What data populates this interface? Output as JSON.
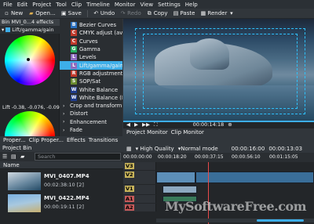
{
  "menu": [
    "File",
    "Edit",
    "Project",
    "Tool",
    "Clip",
    "Timeline",
    "Monitor",
    "View",
    "Settings",
    "Help"
  ],
  "toolbar": {
    "new": "New",
    "open": "Open...",
    "save": "Save",
    "undo": "Undo",
    "redo": "Redo",
    "copy": "Copy",
    "paste": "Paste",
    "render": "Render"
  },
  "effect_panel": {
    "bin_title": "Bin MVI_0...4 effects",
    "effect_name": "Lift/gamma/gain",
    "lift_value": "Lift -0.38, -0.076, -0.09:"
  },
  "effect_list": {
    "items": [
      {
        "badge": "B",
        "label": "Bezier Curves",
        "color": "#2a6fbf"
      },
      {
        "badge": "C",
        "label": "CMYK adjust (avfi",
        "color": "#c0392b"
      },
      {
        "badge": "C",
        "label": "Curves",
        "color": "#c0392b"
      },
      {
        "badge": "G",
        "label": "Gamma",
        "color": "#27ae60"
      },
      {
        "badge": "L",
        "label": "Levels",
        "color": "#8e6bbf"
      },
      {
        "badge": "L",
        "label": "Lift/gamma/gain",
        "color": "#8e6bbf",
        "selected": true
      },
      {
        "badge": "R",
        "label": "RGB adjustment",
        "color": "#c0392b"
      },
      {
        "badge": "S",
        "label": "SOP/Sat",
        "color": "#6a8a2f"
      },
      {
        "badge": "W",
        "label": "White Balance",
        "color": "#1e3a8a"
      },
      {
        "badge": "W",
        "label": "White Balance (LM",
        "color": "#1e3a8a"
      }
    ],
    "categories": [
      "Crop and transform",
      "Distort",
      "Enhancement",
      "Fade"
    ]
  },
  "monitor": {
    "timecode": "00:00:14:18",
    "tabs": [
      "Project Monitor",
      "Clip Monitor"
    ]
  },
  "left_tabs": [
    "Proper...",
    "Clip Proper...",
    "Effects",
    "Transitions"
  ],
  "timeline": {
    "quality": "High Quality",
    "mode": "Normal mode",
    "timecode1": "00:00:16:00",
    "timecode2": "00:00:13:03",
    "ruler": [
      "00:00:00:00",
      "00:00:18:20",
      "00:00:37:15",
      "00:00:56:10",
      "00:01:15:05"
    ],
    "tracks": [
      "V3",
      "V2",
      "V1",
      "A1",
      "A2"
    ],
    "track_colors": {
      "video": "#5d8fb8",
      "clip": "#8da8c0",
      "audio": "#3a7a5a",
      "label_video": "#c7b35a",
      "label_audio": "#c75a5a"
    }
  },
  "bin": {
    "header": "Project Bin",
    "search_placeholder": "Search",
    "column": "Name",
    "items": [
      {
        "name": "MVI_0407.MP4",
        "duration": "00:02:38:10 [2]"
      },
      {
        "name": "MVI_0422.MP4",
        "duration": "00:00:19:11 [2]"
      }
    ]
  },
  "watermark": "MySoftwareFree.com"
}
